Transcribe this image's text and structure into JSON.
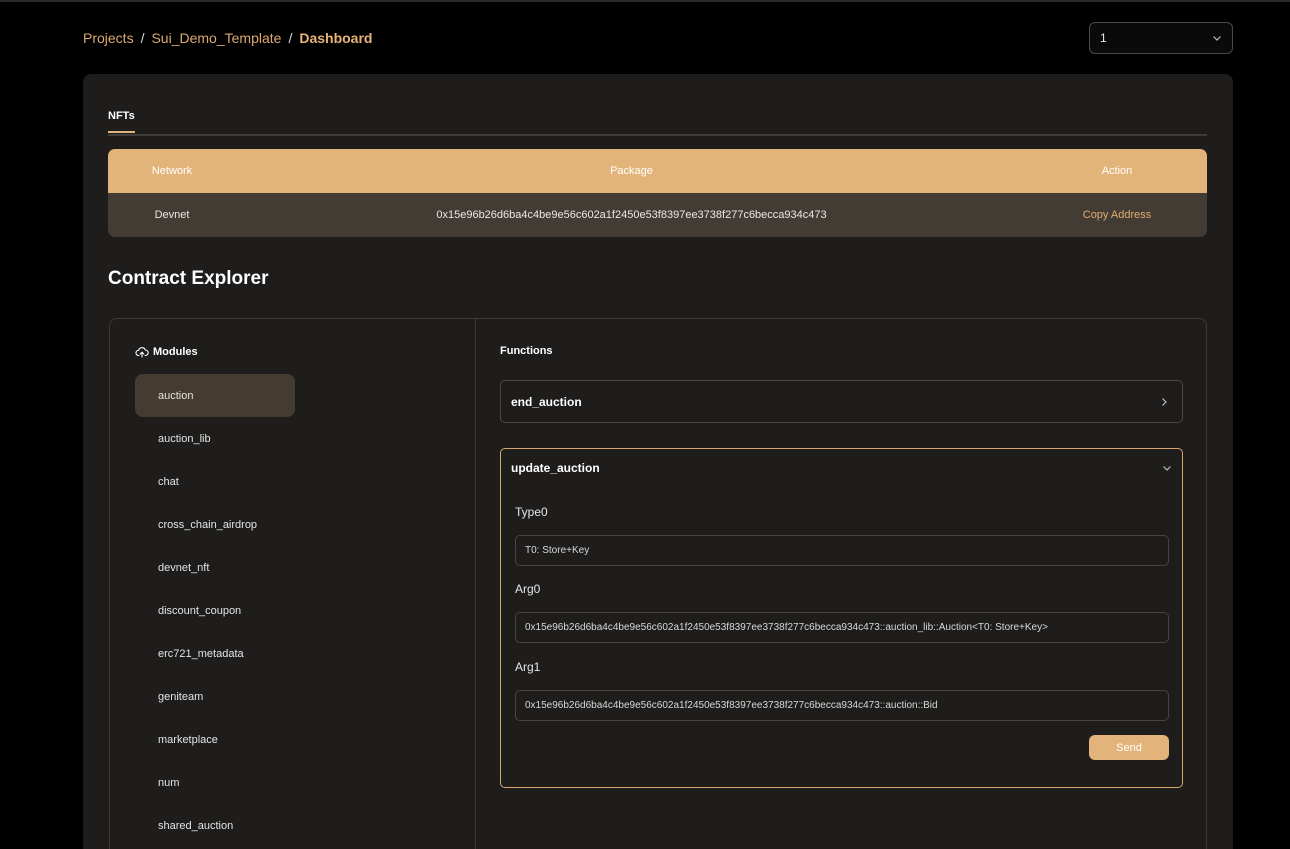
{
  "breadcrumb": {
    "items": [
      "Projects",
      "Sui_Demo_Template"
    ],
    "separator": "/",
    "current": "Dashboard"
  },
  "selector": {
    "value": "1"
  },
  "tabs": [
    {
      "label": "NFTs",
      "active": true
    }
  ],
  "table": {
    "headers": {
      "network": "Network",
      "package": "Package",
      "action": "Action"
    },
    "rows": [
      {
        "network": "Devnet",
        "package": "0x15e96b26d6ba4c4be9e56c602a1f2450e53f8397ee3738f277c6becca934c473",
        "action": "Copy Address"
      }
    ]
  },
  "explorer": {
    "title": "Contract Explorer",
    "modules_label": "Modules",
    "modules": [
      "auction",
      "auction_lib",
      "chat",
      "cross_chain_airdrop",
      "devnet_nft",
      "discount_coupon",
      "erc721_metadata",
      "geniteam",
      "marketplace",
      "num",
      "shared_auction"
    ],
    "active_module": "auction",
    "functions_label": "Functions",
    "functions": [
      {
        "name": "end_auction",
        "expanded": false
      },
      {
        "name": "update_auction",
        "expanded": true
      }
    ],
    "open_function": {
      "name": "update_auction",
      "fields": [
        {
          "label": "Type0",
          "value": "T0: Store+Key"
        },
        {
          "label": "Arg0",
          "value": "0x15e96b26d6ba4c4be9e56c602a1f2450e53f8397ee3738f277c6becca934c473::auction_lib::Auction<T0: Store+Key>"
        },
        {
          "label": "Arg1",
          "value": "0x15e96b26d6ba4c4be9e56c602a1f2450e53f8397ee3738f277c6becca934c473::auction::Bid"
        }
      ],
      "send_label": "Send"
    }
  },
  "colors": {
    "accent": "#e2b37a",
    "active_module_bg": "#443b31",
    "table_row_bg": "#433c34",
    "card_bg": "#1e1d1c"
  },
  "icons": {
    "select": "chevron-down-icon",
    "modules": "cloud-upload-icon",
    "collapsed_fn": "chevron-right-icon",
    "open_fn": "chevron-down-icon"
  }
}
